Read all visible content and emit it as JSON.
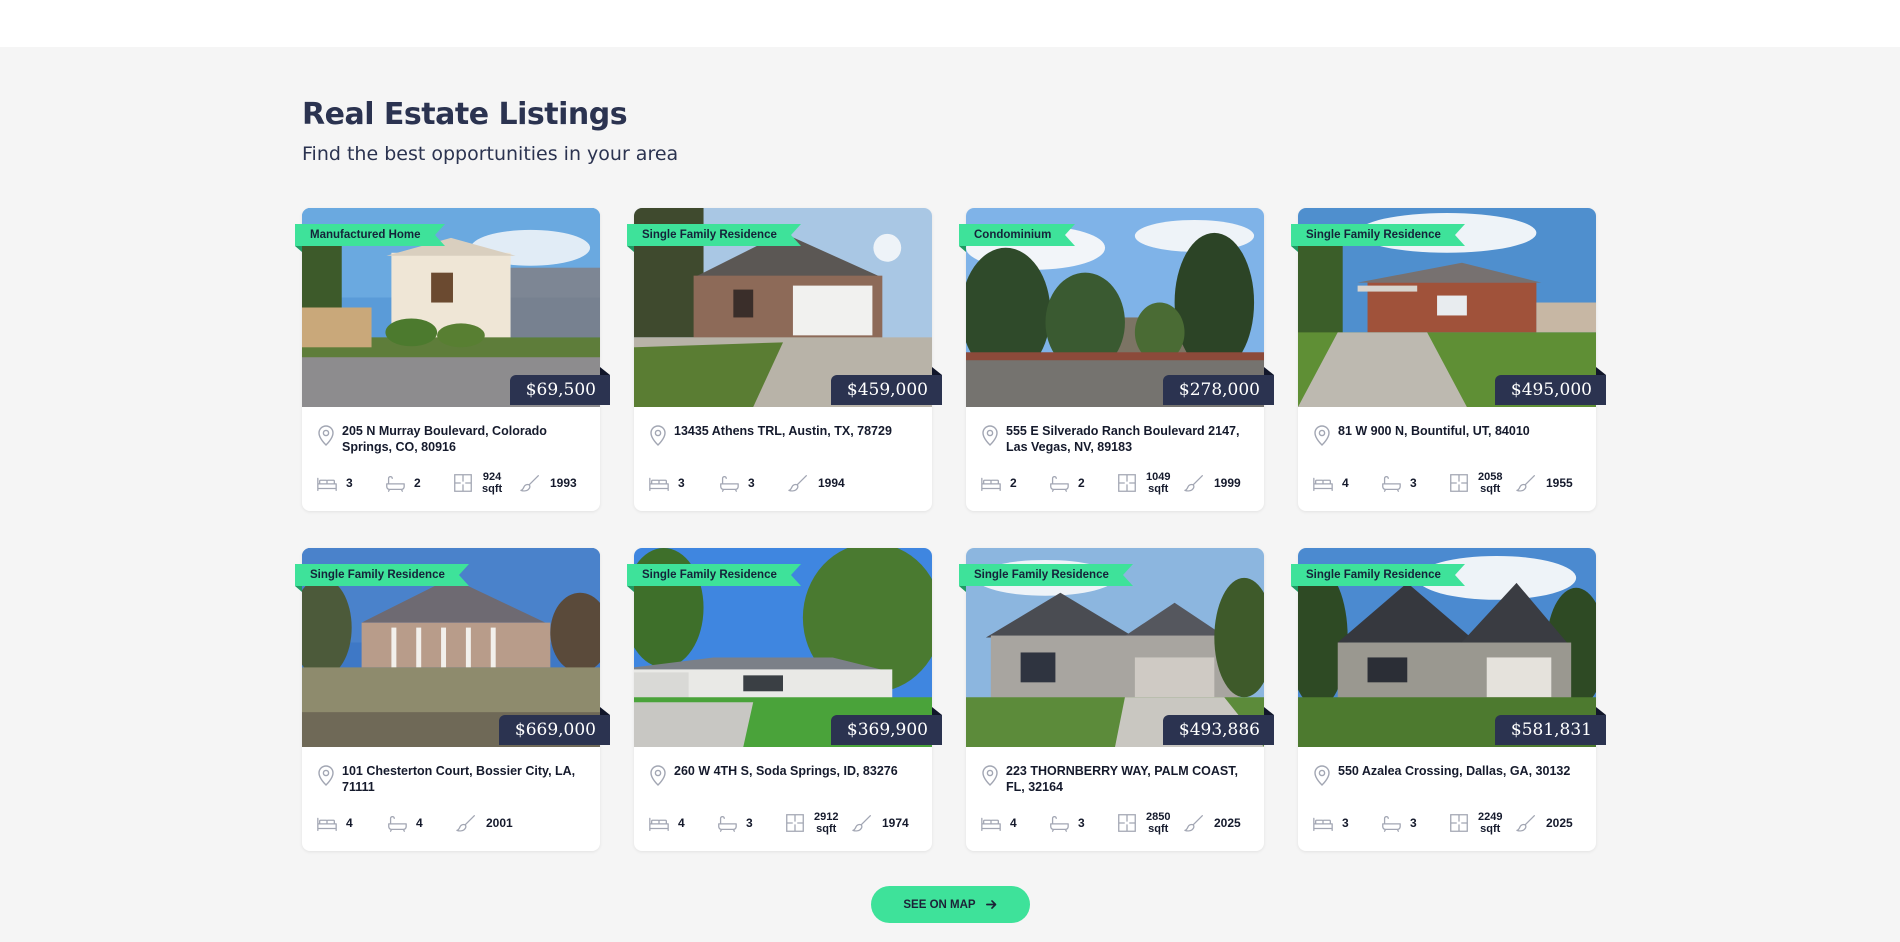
{
  "header": {
    "title": "Real Estate Listings",
    "subtitle": "Find the best opportunities in your area"
  },
  "listings": [
    {
      "type": "Manufactured Home",
      "price": "$69,500",
      "address": "205 N Murray Boulevard, Colorado Springs, CO, 80916",
      "beds": "3",
      "baths": "2",
      "area": "924",
      "area_unit": "sqft",
      "year": "1993",
      "photo": "manufactured-home-photo"
    },
    {
      "type": "Single Family Residence",
      "price": "$459,000",
      "address": "13435 Athens TRL, Austin, TX, 78729",
      "beds": "3",
      "baths": "3",
      "area": "",
      "area_unit": "",
      "year": "1994",
      "photo": "brick-house-photo"
    },
    {
      "type": "Condominium",
      "price": "$278,000",
      "address": "555 E Silverado Ranch Boulevard 2147, Las Vegas, NV, 89183",
      "beds": "2",
      "baths": "2",
      "area": "1049",
      "area_unit": "sqft",
      "year": "1999",
      "photo": "condo-trees-photo"
    },
    {
      "type": "Single Family Residence",
      "price": "$495,000",
      "address": "81 W 900 N, Bountiful, UT, 84010",
      "beds": "4",
      "baths": "3",
      "area": "2058",
      "area_unit": "sqft",
      "year": "1955",
      "photo": "ranch-house-photo"
    },
    {
      "type": "Single Family Residence",
      "price": "$669,000",
      "address": "101 Chesterton Court, Bossier City, LA, 71111",
      "beds": "4",
      "baths": "4",
      "area": "",
      "area_unit": "",
      "year": "2001",
      "photo": "columned-house-photo"
    },
    {
      "type": "Single Family Residence",
      "price": "$369,900",
      "address": "260 W 4TH S, Soda Springs, ID, 83276",
      "beds": "4",
      "baths": "3",
      "area": "2912",
      "area_unit": "sqft",
      "year": "1974",
      "photo": "white-ranch-photo"
    },
    {
      "type": "Single Family Residence",
      "price": "$493,886",
      "address": "223 THORNBERRY WAY, PALM COAST, FL, 32164",
      "beds": "4",
      "baths": "3",
      "area": "2850",
      "area_unit": "sqft",
      "year": "2025",
      "photo": "gray-house-photo"
    },
    {
      "type": "Single Family Residence",
      "price": "$581,831",
      "address": "550 Azalea Crossing, Dallas, GA, 30132",
      "beds": "3",
      "baths": "3",
      "area": "2249",
      "area_unit": "sqft",
      "year": "2025",
      "photo": "craftsman-house-photo"
    }
  ],
  "actions": {
    "see_on_map": "SEE ON MAP"
  },
  "colors": {
    "accent": "#3ee29a",
    "navy": "#2b3350",
    "background": "#f5f5f5"
  }
}
